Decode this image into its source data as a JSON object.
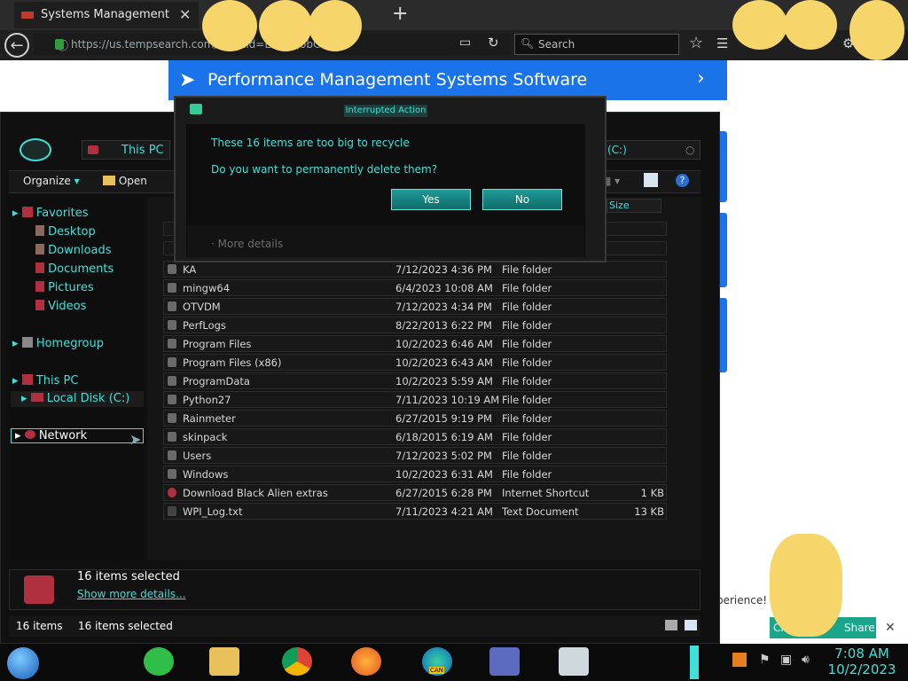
{
  "browser": {
    "tab_title": "Systems Management Software",
    "url": "https://us.tempsearch.com/ds...cid=EAIaIQobChM...",
    "search_placeholder": "Search"
  },
  "webpage": {
    "banner_title": "Performance Management Systems Software",
    "cookie_text": "perience! Lea...",
    "choose_label": "Cho...",
    "share_label": "Share",
    "accent_color": "#1a73e8"
  },
  "explorer": {
    "address_crumb": "This PC",
    "address_drive": "(C:)",
    "toolbar": {
      "organize": "Organize",
      "open": "Open"
    },
    "columns": {
      "size": "Size"
    },
    "nav": [
      {
        "label": "Favorites"
      },
      {
        "label": "Desktop"
      },
      {
        "label": "Downloads"
      },
      {
        "label": "Documents"
      },
      {
        "label": "Pictures"
      },
      {
        "label": "Videos"
      },
      {
        "label": "Homegroup"
      },
      {
        "label": "This PC"
      },
      {
        "label": "Local Disk (C:)"
      },
      {
        "label": "Network"
      }
    ],
    "files": [
      {
        "name": "KA",
        "date": "7/12/2023 4:36 PM",
        "type": "File folder",
        "size": ""
      },
      {
        "name": "mingw64",
        "date": "6/4/2023 10:08 AM",
        "type": "File folder",
        "size": ""
      },
      {
        "name": "OTVDM",
        "date": "7/12/2023 4:34 PM",
        "type": "File folder",
        "size": ""
      },
      {
        "name": "PerfLogs",
        "date": "8/22/2013 6:22 PM",
        "type": "File folder",
        "size": ""
      },
      {
        "name": "Program Files",
        "date": "10/2/2023 6:46 AM",
        "type": "File folder",
        "size": ""
      },
      {
        "name": "Program Files (x86)",
        "date": "10/2/2023 6:43 AM",
        "type": "File folder",
        "size": ""
      },
      {
        "name": "ProgramData",
        "date": "10/2/2023 5:59 AM",
        "type": "File folder",
        "size": ""
      },
      {
        "name": "Python27",
        "date": "7/11/2023 10:19 AM",
        "type": "File folder",
        "size": ""
      },
      {
        "name": "Rainmeter",
        "date": "6/27/2015 9:19 PM",
        "type": "File folder",
        "size": ""
      },
      {
        "name": "skinpack",
        "date": "6/18/2015 6:19 AM",
        "type": "File folder",
        "size": ""
      },
      {
        "name": "Users",
        "date": "7/12/2023 5:02 PM",
        "type": "File folder",
        "size": ""
      },
      {
        "name": "Windows",
        "date": "10/2/2023 6:31 AM",
        "type": "File folder",
        "size": ""
      },
      {
        "name": "Download Black Alien extras",
        "date": "6/27/2015 6:28 PM",
        "type": "Internet Shortcut",
        "size": "1 KB"
      },
      {
        "name": "WPI_Log.txt",
        "date": "7/11/2023 4:21 AM",
        "type": "Text Document",
        "size": "13 KB"
      }
    ],
    "details": {
      "selected": "16 items selected",
      "show_more": "Show more details..."
    },
    "status": {
      "count": "16 items",
      "selected": "16 items selected"
    }
  },
  "dialog": {
    "title": "Interrupted Action",
    "message": "These 16 items are too big to recycle",
    "question": "Do you want to permanently delete them?",
    "yes_label": "Yes",
    "no_label": "No",
    "more_details": "More details"
  },
  "taskbar": {
    "time": "7:08 AM",
    "date": "10/2/2023",
    "apps": [
      "chat-icon",
      "file-explorer-icon",
      "chrome-icon",
      "firefox-icon",
      "edge-can-icon",
      "card-icon",
      "monitor-icon"
    ],
    "edge_badge": "CAN"
  },
  "theme": {
    "cyan": "#3fe0d8",
    "dark": "#101010"
  }
}
